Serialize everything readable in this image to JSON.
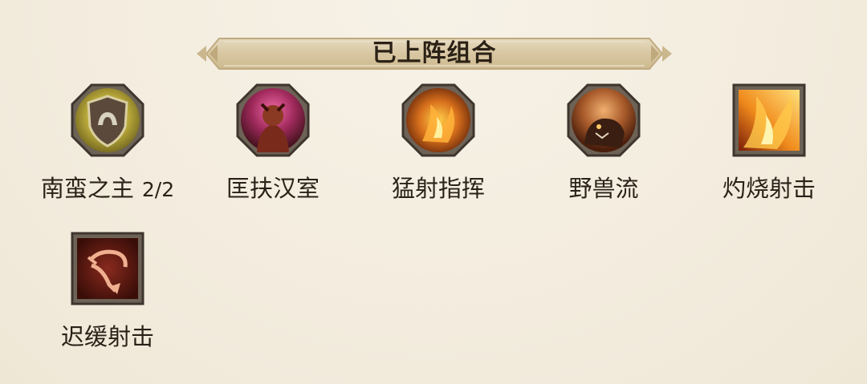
{
  "header": {
    "title": "已上阵组合"
  },
  "combos": [
    {
      "name": "南蛮之主",
      "count": "2/2",
      "icon": "barbarian-shield-icon"
    },
    {
      "name": "匡扶汉室",
      "count": "",
      "icon": "warrior-portrait-icon"
    },
    {
      "name": "猛射指挥",
      "count": "",
      "icon": "fire-command-icon"
    },
    {
      "name": "野兽流",
      "count": "",
      "icon": "beast-icon"
    },
    {
      "name": "灼烧射击",
      "count": "",
      "icon": "flame-shot-icon"
    },
    {
      "name": "迟缓射击",
      "count": "",
      "icon": "bow-icon"
    }
  ],
  "colors": {
    "background": "#f4eee1",
    "banner": "#d9c9a6",
    "gold_frame": "#b8a060",
    "dark_frame": "#5a5048"
  }
}
